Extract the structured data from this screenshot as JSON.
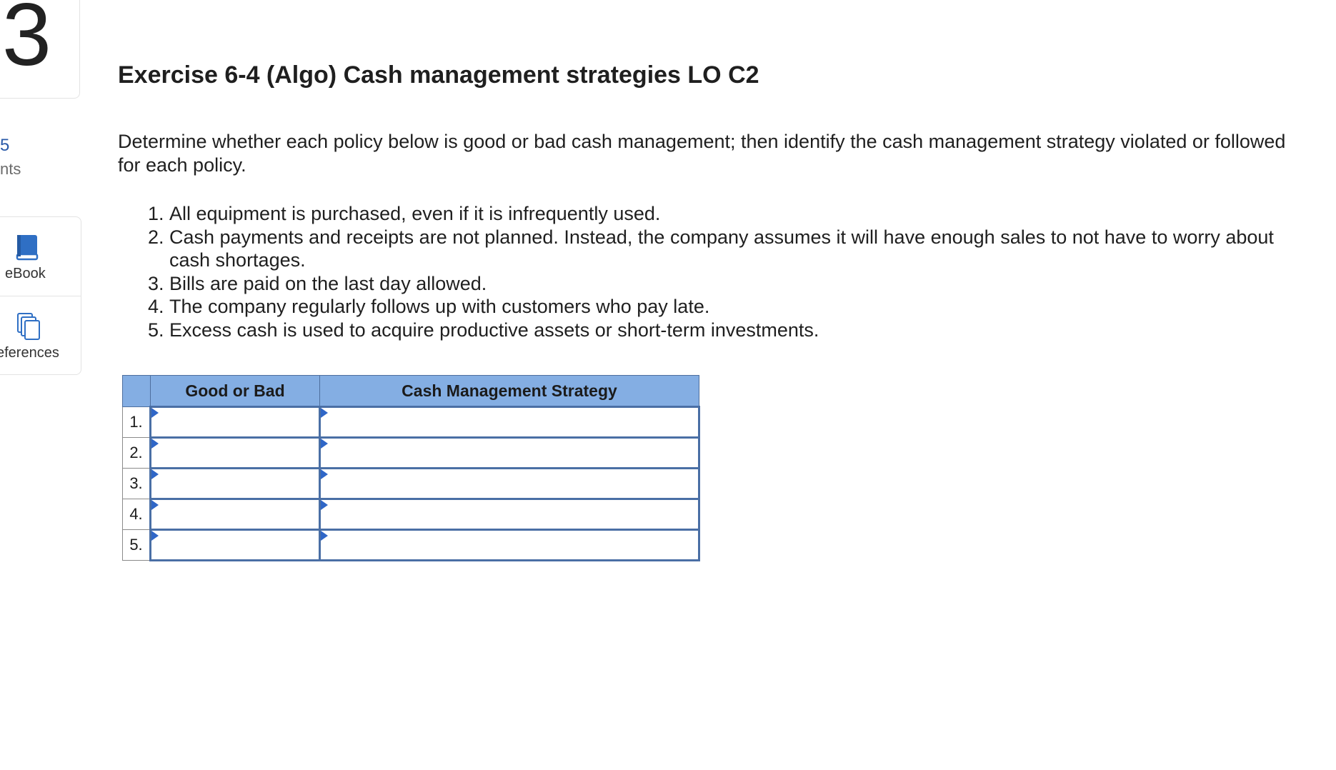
{
  "sidebar": {
    "question_number": "3",
    "points_value": "5",
    "points_label": "nts",
    "tools": [
      {
        "label": "eBook",
        "icon": "book-icon"
      },
      {
        "label": "eferences",
        "icon": "copy-pages-icon"
      }
    ]
  },
  "main": {
    "title": "Exercise 6-4 (Algo) Cash management strategies LO C2",
    "instructions": "Determine whether each policy below is good or bad cash management; then identify the cash management strategy violated or followed for each policy.",
    "policies": [
      {
        "num": "1.",
        "text": "All equipment is purchased, even if it is infrequently used."
      },
      {
        "num": "2.",
        "text": "Cash payments and receipts are not planned. Instead, the company assumes it will have enough sales to not have to worry about cash shortages."
      },
      {
        "num": "3.",
        "text": "Bills are paid on the last day allowed."
      },
      {
        "num": "4.",
        "text": "The company regularly follows up with customers who pay late."
      },
      {
        "num": "5.",
        "text": "Excess cash is used to acquire productive assets or short-term investments."
      }
    ],
    "table": {
      "headers": [
        "Good or Bad",
        "Cash Management Strategy"
      ],
      "rows": [
        {
          "num": "1.",
          "good_or_bad": "",
          "strategy": ""
        },
        {
          "num": "2.",
          "good_or_bad": "",
          "strategy": ""
        },
        {
          "num": "3.",
          "good_or_bad": "",
          "strategy": ""
        },
        {
          "num": "4.",
          "good_or_bad": "",
          "strategy": ""
        },
        {
          "num": "5.",
          "good_or_bad": "",
          "strategy": ""
        }
      ]
    }
  },
  "colors": {
    "header_fill": "#84aee3",
    "input_border": "#4a6fa5",
    "dropdown_marker": "#2f66c7",
    "points_color": "#2a5aa8"
  }
}
